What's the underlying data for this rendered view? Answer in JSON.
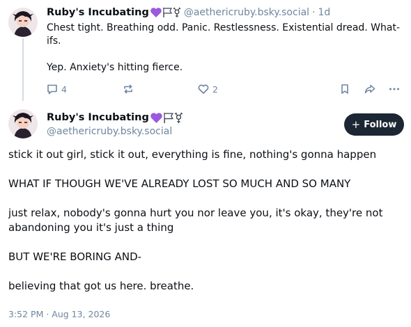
{
  "reply_post": {
    "author_name": "Ruby's Incubating",
    "badge_icons": [
      "purple-heart-icon",
      "white-flag-icon",
      "transgender-symbol-icon"
    ],
    "handle": "@aethericruby.bsky.social",
    "separator": "·",
    "age": "1d",
    "paragraphs": [
      "Chest tight. Breathing odd. Panic. Restlessness. Existential dread. What-ifs.",
      "Yep. Anxiety's hitting fierce."
    ],
    "reply_count": "4",
    "like_count": "2"
  },
  "main_post": {
    "author_name": "Ruby's Incubating",
    "badge_icons": [
      "purple-heart-icon",
      "white-flag-icon",
      "transgender-symbol-icon"
    ],
    "handle": "@aethericruby.bsky.social",
    "follow_label": "Follow",
    "paragraphs": [
      "stick it out girl, stick it out, everything is fine, nothing's gonna happen",
      "WHAT IF THOUGH WE'VE ALREADY LOST SO MUCH AND SO MANY",
      "just relax, nobody's gonna hurt you nor leave you, it's okay, they're not abandoning you it's just a thing",
      "BUT WE'RE BORING AND-",
      "believing that got us here. breathe."
    ],
    "timestamp": "3:52 PM · Aug 13, 2026"
  },
  "colors": {
    "heart": "#9b59e0",
    "muted_text": "#6f869f",
    "follow_button_bg": "#1c2733",
    "thread_line": "#d4dbe2"
  }
}
